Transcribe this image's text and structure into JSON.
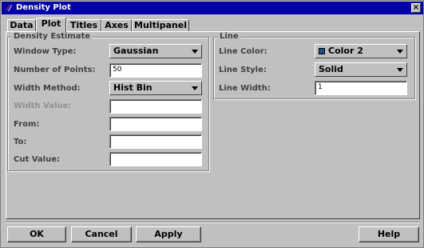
{
  "window": {
    "title": "Density Plot"
  },
  "tabs": [
    {
      "label": "Data"
    },
    {
      "label": "Plot"
    },
    {
      "label": "Titles"
    },
    {
      "label": "Axes"
    },
    {
      "label": "Multipanel"
    }
  ],
  "active_tab": "Plot",
  "density_estimate": {
    "legend": "Density Estimate",
    "window_type": {
      "label": "Window Type:",
      "value": "Gaussian"
    },
    "number_of_points": {
      "label": "Number of Points:",
      "value": "50"
    },
    "width_method": {
      "label": "Width Method:",
      "value": "Hist Bin"
    },
    "width_value": {
      "label": "Width Value:",
      "value": ""
    },
    "from": {
      "label": "From:",
      "value": ""
    },
    "to": {
      "label": "To:",
      "value": ""
    },
    "cut_value": {
      "label": "Cut Value:",
      "value": ""
    }
  },
  "line": {
    "legend": "Line",
    "line_color": {
      "label": "Line Color:",
      "value": "Color 2",
      "swatch": "#1f4f7f"
    },
    "line_style": {
      "label": "Line Style:",
      "value": "Solid"
    },
    "line_width": {
      "label": "Line Width:",
      "value": "1"
    }
  },
  "buttons": {
    "ok": "OK",
    "cancel": "Cancel",
    "apply": "Apply",
    "help": "Help"
  }
}
